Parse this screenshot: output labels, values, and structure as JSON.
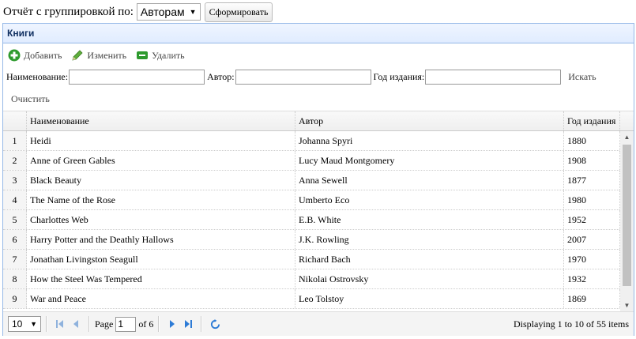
{
  "report": {
    "label": "Отчёт с группировкой по:",
    "group_value": "Авторам",
    "submit_label": "Сформировать"
  },
  "panel": {
    "title": "Книги"
  },
  "toolbar": {
    "add": "Добавить",
    "edit": "Изменить",
    "delete": "Удалить"
  },
  "filters": {
    "name_label": "Наименование:",
    "author_label": "Автор:",
    "year_label": "Год издания:",
    "search": "Искать",
    "clear": "Очистить"
  },
  "grid": {
    "columns": [
      "Наименование",
      "Автор",
      "Год издания"
    ],
    "rows": [
      {
        "n": "1",
        "title": "Heidi",
        "author": "Johanna Spyri",
        "year": "1880"
      },
      {
        "n": "2",
        "title": "Anne of Green Gables",
        "author": "Lucy Maud Montgomery",
        "year": "1908"
      },
      {
        "n": "3",
        "title": "Black Beauty",
        "author": "Anna Sewell",
        "year": "1877"
      },
      {
        "n": "4",
        "title": "The Name of the Rose",
        "author": "Umberto Eco",
        "year": "1980"
      },
      {
        "n": "5",
        "title": "Charlottes Web",
        "author": "E.B. White",
        "year": "1952"
      },
      {
        "n": "6",
        "title": "Harry Potter and the Deathly Hallows",
        "author": "J.K. Rowling",
        "year": "2007"
      },
      {
        "n": "7",
        "title": "Jonathan Livingston Seagull",
        "author": "Richard Bach",
        "year": "1970"
      },
      {
        "n": "8",
        "title": "How the Steel Was Tempered",
        "author": "Nikolai Ostrovsky",
        "year": "1932"
      },
      {
        "n": "9",
        "title": "War and Peace",
        "author": "Leo Tolstoy",
        "year": "1869"
      }
    ]
  },
  "pager": {
    "page_size": "10",
    "page_label": "Page",
    "page": "1",
    "of_label": "of 6",
    "display": "Displaying 1 to 10 of 55 items"
  },
  "colors": {
    "header_border": "#95b8e7",
    "title_text": "#0e2d5f",
    "pager_icon": "#2d7bd6"
  }
}
